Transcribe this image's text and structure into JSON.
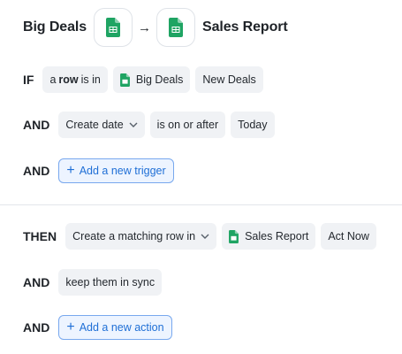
{
  "header": {
    "source_title": "Big Deals",
    "arrow": "→",
    "target_title": "Sales Report",
    "icon": "google-sheets-icon"
  },
  "trigger": {
    "if_kw": "IF",
    "row_prefix": "a",
    "row_bold": "row",
    "row_suffix": "is in",
    "sheet_name": "Big Deals",
    "tab_name": "New Deals",
    "and_kw_1": "AND",
    "field": "Create date",
    "operator": "is on or after",
    "value": "Today",
    "and_kw_2": "AND",
    "add_trigger_label": "Add a new trigger"
  },
  "action": {
    "then_kw": "THEN",
    "action_label": "Create a matching row in",
    "sheet_name": "Sales Report",
    "tab_name": "Act Now",
    "and_kw_1": "AND",
    "sync_label": "keep them in sync",
    "and_kw_2": "AND",
    "add_action_label": "Add a new action"
  },
  "colors": {
    "sheets_green": "#1fa463",
    "add_button_blue": "#1f6fd6"
  }
}
